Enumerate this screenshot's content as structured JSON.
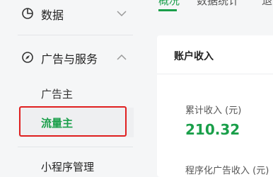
{
  "sidebar": {
    "data_item": {
      "label": "数据",
      "icon": "pie-chart-icon"
    },
    "ads_section": {
      "label": "广告与服务",
      "icon": "compass-icon"
    },
    "sub_items": [
      {
        "label": "广告主"
      },
      {
        "label": "流量主"
      }
    ],
    "miniprogram_item": {
      "label": "小程序管理"
    }
  },
  "top_tabs": [
    {
      "label": "概况"
    },
    {
      "label": "数据统计"
    },
    {
      "label": "退"
    }
  ],
  "account_card": {
    "title": "账户收入",
    "cumulative_label": "累计收入 (元)",
    "cumulative_value": "210.32",
    "programmatic_label": "程序化广告收入 (元)"
  },
  "colors": {
    "accent": "#1a9f4a",
    "highlight": "#e02020"
  }
}
